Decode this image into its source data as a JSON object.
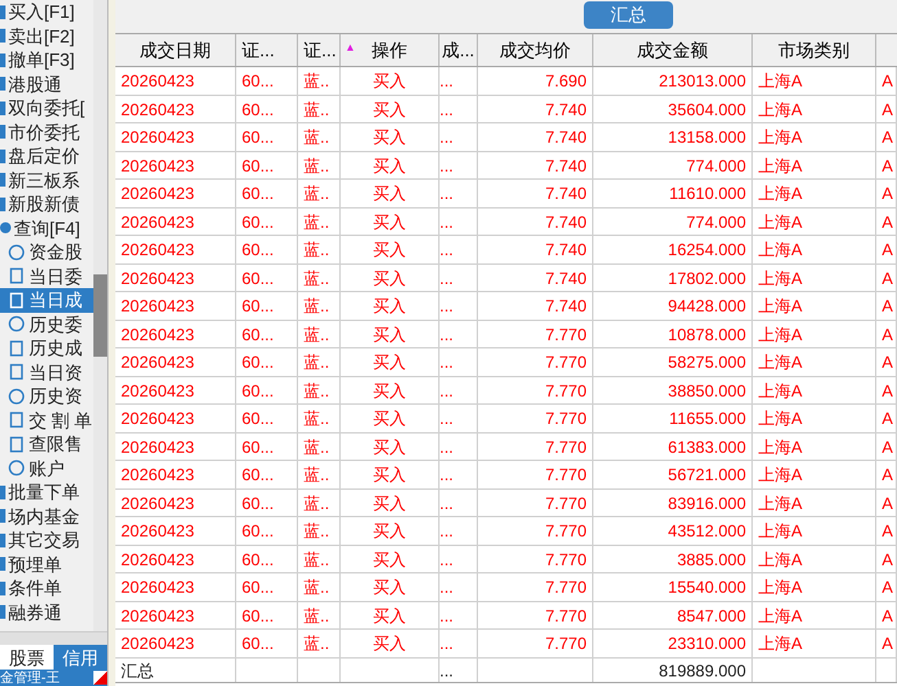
{
  "sidebar": {
    "items": [
      {
        "label": "买入[F1]"
      },
      {
        "label": "卖出[F2]"
      },
      {
        "label": "撤单[F3]"
      },
      {
        "label": "港股通"
      },
      {
        "label": "双向委托["
      },
      {
        "label": "市价委托"
      },
      {
        "label": "盘后定价"
      },
      {
        "label": "新三板系"
      },
      {
        "label": "新股新债"
      },
      {
        "label": "查询[F4]",
        "expanded": true,
        "children": [
          {
            "label": "资金股",
            "selected": false
          },
          {
            "label": "当日委",
            "selected": false
          },
          {
            "label": "当日成",
            "selected": true
          },
          {
            "label": "历史委",
            "selected": false
          },
          {
            "label": "历史成",
            "selected": false
          },
          {
            "label": "当日资",
            "selected": false
          },
          {
            "label": "历史资",
            "selected": false
          },
          {
            "label": "交 割 单",
            "selected": false
          },
          {
            "label": "查限售",
            "selected": false
          },
          {
            "label": "账户",
            "selected": false
          }
        ]
      },
      {
        "label": "批量下单"
      },
      {
        "label": "场内基金"
      },
      {
        "label": "其它交易"
      },
      {
        "label": "预埋单"
      },
      {
        "label": "条件单"
      },
      {
        "label": "融券通"
      }
    ],
    "tabs": [
      {
        "label": "股票",
        "selected": false
      },
      {
        "label": "信用",
        "selected": true
      }
    ],
    "status": "金管理-王"
  },
  "toolbar": {
    "button": "汇总"
  },
  "table": {
    "columns": [
      {
        "label": "成交日期"
      },
      {
        "label": "证..."
      },
      {
        "label": "证..."
      },
      {
        "label": "操作",
        "sort_mark": "▲"
      },
      {
        "label": "成..."
      },
      {
        "label": "成交均价"
      },
      {
        "label": "成交金额"
      },
      {
        "label": "市场类别"
      },
      {}
    ],
    "rows": [
      [
        "20260423",
        "60...",
        "蓝..",
        "买入",
        "...",
        "7.690",
        "213013.000",
        "上海A",
        "A"
      ],
      [
        "20260423",
        "60...",
        "蓝..",
        "买入",
        "...",
        "7.740",
        "35604.000",
        "上海A",
        "A"
      ],
      [
        "20260423",
        "60...",
        "蓝..",
        "买入",
        "...",
        "7.740",
        "13158.000",
        "上海A",
        "A"
      ],
      [
        "20260423",
        "60...",
        "蓝..",
        "买入",
        "...",
        "7.740",
        "774.000",
        "上海A",
        "A"
      ],
      [
        "20260423",
        "60...",
        "蓝..",
        "买入",
        "...",
        "7.740",
        "11610.000",
        "上海A",
        "A"
      ],
      [
        "20260423",
        "60...",
        "蓝..",
        "买入",
        "...",
        "7.740",
        "774.000",
        "上海A",
        "A"
      ],
      [
        "20260423",
        "60...",
        "蓝..",
        "买入",
        "...",
        "7.740",
        "16254.000",
        "上海A",
        "A"
      ],
      [
        "20260423",
        "60...",
        "蓝..",
        "买入",
        "...",
        "7.740",
        "17802.000",
        "上海A",
        "A"
      ],
      [
        "20260423",
        "60...",
        "蓝..",
        "买入",
        "...",
        "7.740",
        "94428.000",
        "上海A",
        "A"
      ],
      [
        "20260423",
        "60...",
        "蓝..",
        "买入",
        "...",
        "7.770",
        "10878.000",
        "上海A",
        "A"
      ],
      [
        "20260423",
        "60...",
        "蓝..",
        "买入",
        "...",
        "7.770",
        "58275.000",
        "上海A",
        "A"
      ],
      [
        "20260423",
        "60...",
        "蓝..",
        "买入",
        "...",
        "7.770",
        "38850.000",
        "上海A",
        "A"
      ],
      [
        "20260423",
        "60...",
        "蓝..",
        "买入",
        "...",
        "7.770",
        "11655.000",
        "上海A",
        "A"
      ],
      [
        "20260423",
        "60...",
        "蓝..",
        "买入",
        "...",
        "7.770",
        "61383.000",
        "上海A",
        "A"
      ],
      [
        "20260423",
        "60...",
        "蓝..",
        "买入",
        "...",
        "7.770",
        "56721.000",
        "上海A",
        "A"
      ],
      [
        "20260423",
        "60...",
        "蓝..",
        "买入",
        "...",
        "7.770",
        "83916.000",
        "上海A",
        "A"
      ],
      [
        "20260423",
        "60...",
        "蓝..",
        "买入",
        "...",
        "7.770",
        "43512.000",
        "上海A",
        "A"
      ],
      [
        "20260423",
        "60...",
        "蓝..",
        "买入",
        "...",
        "7.770",
        "3885.000",
        "上海A",
        "A"
      ],
      [
        "20260423",
        "60...",
        "蓝..",
        "买入",
        "...",
        "7.770",
        "15540.000",
        "上海A",
        "A"
      ],
      [
        "20260423",
        "60...",
        "蓝..",
        "买入",
        "...",
        "7.770",
        "8547.000",
        "上海A",
        "A"
      ],
      [
        "20260423",
        "60...",
        "蓝..",
        "买入",
        "...",
        "7.770",
        "23310.000",
        "上海A",
        "A"
      ]
    ],
    "total": {
      "label": "汇总",
      "column_5": "...",
      "amount": "819889.000"
    }
  }
}
